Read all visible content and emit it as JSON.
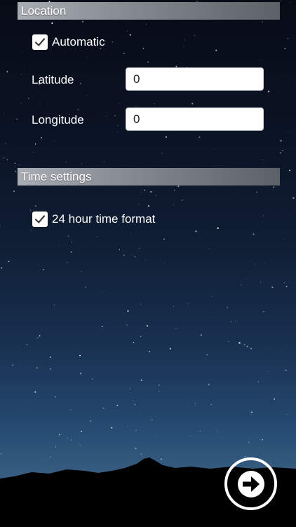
{
  "location": {
    "header": "Location",
    "automatic_label": "Automatic",
    "automatic_checked": true,
    "latitude_label": "Latitude",
    "latitude_value": "0",
    "longitude_label": "Longitude",
    "longitude_value": "0"
  },
  "time_settings": {
    "header": "Time settings",
    "format_24h_label": "24 hour time format",
    "format_24h_checked": true
  },
  "next_button": {
    "icon": "arrow-right-icon"
  },
  "colors": {
    "header_gradient_start": "#a8acb3",
    "header_gradient_end": "#5c6168",
    "sky_top": "#070b16",
    "sky_bottom": "#4a6f8e",
    "silhouette": "#000000"
  }
}
